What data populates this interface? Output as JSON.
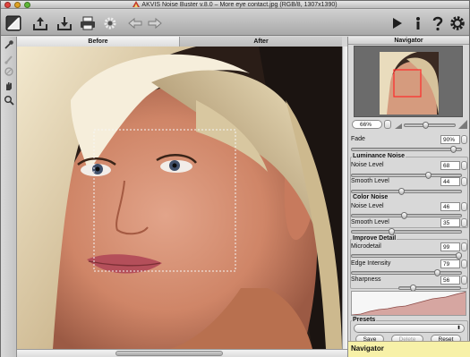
{
  "window": {
    "title": "AKVIS Noise Buster v.8.0 – More eye contact.jpg (RGB/8, 1307x1390)"
  },
  "toolbar": {
    "buttons": [
      "before-after-icon",
      "open-icon",
      "save-icon",
      "print-icon",
      "settings-wheel-icon",
      "back-icon",
      "forward-icon",
      "run-icon",
      "info-icon",
      "help-icon",
      "preferences-icon"
    ]
  },
  "tabs": {
    "before": "Before",
    "after": "After"
  },
  "navigator": {
    "title": "Navigator",
    "zoom": "66%"
  },
  "fade": {
    "label": "Fade",
    "value": "90%",
    "level": 0.9
  },
  "luminance": {
    "title": "Luminance Noise",
    "noise_label": "Noise Level",
    "noise_value": "68",
    "noise_level": 0.68,
    "smooth_label": "Smooth Level",
    "smooth_value": "44",
    "smooth_level": 0.44
  },
  "color": {
    "title": "Color Noise",
    "noise_label": "Noise Level",
    "noise_value": "46",
    "noise_level": 0.46,
    "smooth_label": "Smooth Level",
    "smooth_value": "35",
    "smooth_level": 0.35
  },
  "improve": {
    "title": "Improve Detail",
    "micro_label": "Microdetail",
    "micro_value": "99",
    "micro_level": 0.99,
    "edge_label": "Edge Intensity",
    "edge_value": "79",
    "edge_level": 0.79,
    "sharp_label": "Sharpness",
    "sharp_value": "56",
    "sharp_level": 0.56
  },
  "presets": {
    "title": "Presets",
    "save": "Save",
    "delete": "Delete",
    "reset": "Reset"
  },
  "footer": {
    "label": "Navigator"
  }
}
